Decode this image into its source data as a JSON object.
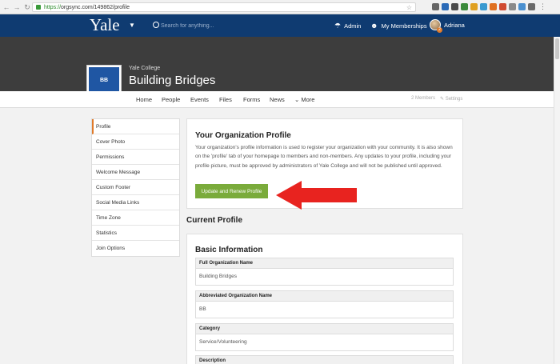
{
  "browser": {
    "url_secure": "https://",
    "url_rest": "orgsync.com/149862/profile"
  },
  "header": {
    "logo": "Yale",
    "search_placeholder": "Search for anything...",
    "admin_label": "Admin",
    "memberships_label": "My Memberships",
    "user_name": "Adriana",
    "avatar_badge": "2"
  },
  "org": {
    "initials": "BB",
    "thumb_caption": "Yale College",
    "parent": "Yale College",
    "name": "Building Bridges"
  },
  "nav": {
    "tabs": [
      "Home",
      "People",
      "Events",
      "Files",
      "Forms",
      "News",
      "More"
    ],
    "members": "2 Members",
    "settings": "Settings"
  },
  "sidebar": {
    "items": [
      "Profile",
      "Cover Photo",
      "Permissions",
      "Welcome Message",
      "Custom Footer",
      "Social Media Links",
      "Time Zone",
      "Statistics",
      "Join Options"
    ]
  },
  "profile_card": {
    "title": "Your Organization Profile",
    "body": "Your organization's profile information is used to register your organization with your community. It is also shown on the 'profile' tab of your homepage to members and non-members. Any updates to your profile, including your profile picture, must be approved by administrators of Yale College and will not be published until approved.",
    "button": "Update and Renew Profile"
  },
  "current_profile": {
    "title": "Current Profile",
    "basic_title": "Basic Information",
    "fields": [
      {
        "label": "Full Organization Name",
        "value": "Building Bridges"
      },
      {
        "label": "Abbreviated Organization Name",
        "value": "BB"
      },
      {
        "label": "Category",
        "value": "Service/Volunteering"
      },
      {
        "label": "Description",
        "value": ""
      }
    ]
  },
  "colors": {
    "header": "#0f3b71",
    "banner": "#3d3d3d",
    "button": "#7aab3b",
    "arrow": "#e8231f",
    "accent": "#e07a2a"
  }
}
